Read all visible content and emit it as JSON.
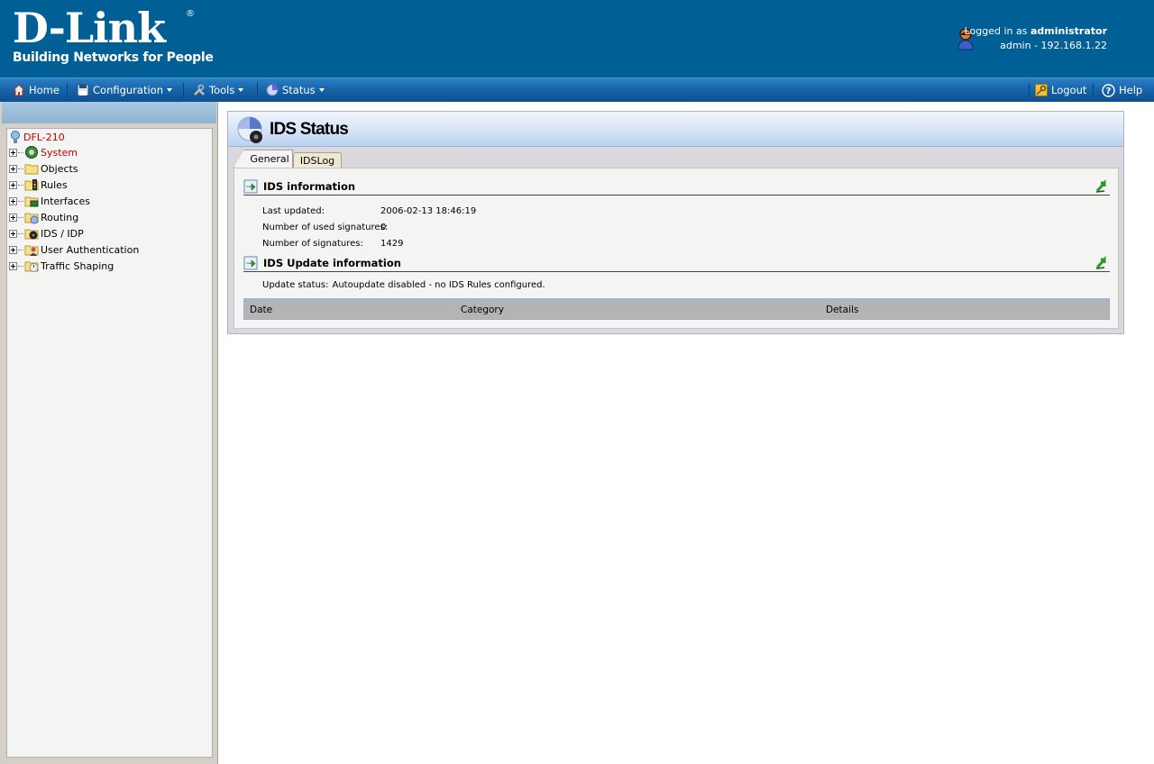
{
  "header": {
    "logo_main": "D-Link",
    "logo_reg": "®",
    "logo_tagline": "Building Networks for People",
    "logged_in_prefix": "Logged in as",
    "logged_in_user": "administrator",
    "session": "admin - 192.168.1.22"
  },
  "menubar": {
    "home": "Home",
    "configuration": "Configuration",
    "tools": "Tools",
    "status": "Status",
    "logout": "Logout",
    "help": "Help"
  },
  "tree": {
    "root": "DFL-210",
    "items": [
      {
        "label": "System",
        "icon": "gear-icon",
        "active": true
      },
      {
        "label": "Objects",
        "icon": "folder-icon"
      },
      {
        "label": "Rules",
        "icon": "rules-folder-icon"
      },
      {
        "label": "Interfaces",
        "icon": "interfaces-folder-icon"
      },
      {
        "label": "Routing",
        "icon": "routing-folder-icon"
      },
      {
        "label": "IDS / IDP",
        "icon": "ids-folder-icon"
      },
      {
        "label": "User Authentication",
        "icon": "user-auth-folder-icon"
      },
      {
        "label": "Traffic Shaping",
        "icon": "traffic-folder-icon"
      }
    ]
  },
  "panel": {
    "title": "IDS Status",
    "tabs": [
      "General",
      "IDSLog"
    ],
    "ids_info": {
      "title": "IDS information",
      "rows": [
        {
          "label": "Last updated:",
          "value": "2006-02-13 18:46:19"
        },
        {
          "label": "Number of used signatures:",
          "value": "0"
        },
        {
          "label": "Number of signatures:",
          "value": "1429"
        }
      ]
    },
    "ids_update": {
      "title": "IDS Update information",
      "status_label": "Update status:",
      "status_value": "Autoupdate disabled - no IDS Rules configured.",
      "columns": [
        "Date",
        "Category",
        "Details"
      ]
    }
  },
  "colors": {
    "header_bg": "#005f94",
    "menubar": "#1563a8",
    "active_tree_item": "#c00000"
  }
}
